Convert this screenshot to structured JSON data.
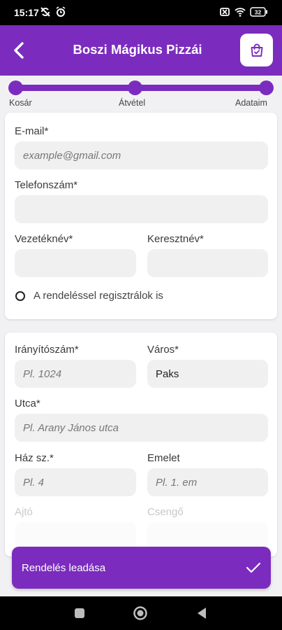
{
  "status_bar": {
    "time": "15:17",
    "battery": "32"
  },
  "app_bar": {
    "title": "Boszi Mágikus Pizzái"
  },
  "stepper": {
    "steps": [
      "Kosár",
      "Átvétel",
      "Adataim"
    ]
  },
  "contact": {
    "email_label": "E-mail*",
    "email_placeholder": "example@gmail.com",
    "phone_label": "Telefonszám*",
    "phone_value": "",
    "lastname_label": "Vezetéknév*",
    "lastname_value": "",
    "firstname_label": "Keresztnév*",
    "firstname_value": "",
    "register_label": "A rendeléssel regisztrálok is"
  },
  "address": {
    "zip_label": "Irányítószám*",
    "zip_placeholder": "Pl. 1024",
    "city_label": "Város*",
    "city_value": "Paks",
    "street_label": "Utca*",
    "street_placeholder": "Pl. Arany János utca",
    "house_label": "Ház sz.*",
    "house_placeholder": "Pl. 4",
    "floor_label": "Emelet",
    "floor_placeholder": "Pl. 1. em",
    "door_label": "Ajtó",
    "bell_label": "Csengő"
  },
  "submit": {
    "label": "Rendelés leadása"
  },
  "colors": {
    "primary": "#7b2cbf",
    "background": "#f1f1f3",
    "input": "#f0f0f0"
  }
}
